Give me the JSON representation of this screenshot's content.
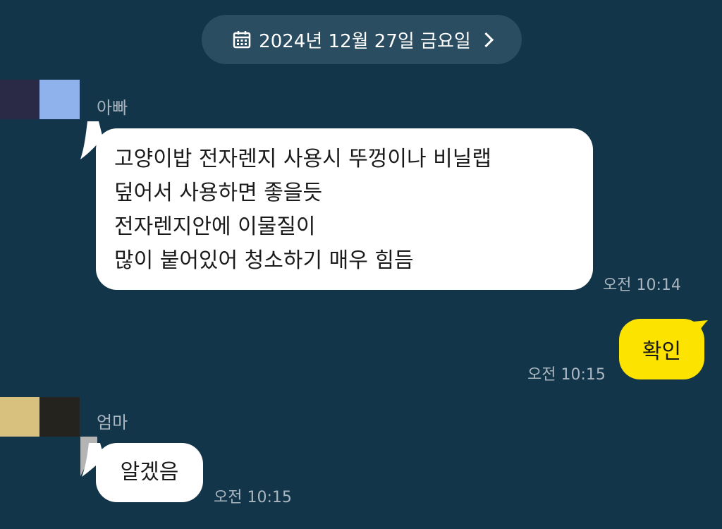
{
  "date_bar": {
    "label": "2024년 12월 27일 금요일",
    "icon": "calendar-icon",
    "chevron": "chevron-right-icon"
  },
  "messages": [
    {
      "sender": "아빠",
      "lines": [
        "고양이밥 전자렌지 사용시 뚜껑이나 비닐랩",
        "덮어서 사용하면 좋을듯",
        "전자렌지안에 이물질이",
        "많이 붙어있어 청소하기 매우 힘듬"
      ],
      "time": "오전 10:14"
    },
    {
      "sender": "me",
      "text": "확인",
      "time": "오전 10:15"
    },
    {
      "sender": "엄마",
      "lines": [
        "알겠음"
      ],
      "time": "오전 10:15"
    }
  ],
  "colors": {
    "background": "#133549",
    "date_pill": "#2b4d61",
    "incoming_bubble": "#ffffff",
    "outgoing_bubble": "#fde400",
    "meta_text": "#a9b6bf"
  }
}
